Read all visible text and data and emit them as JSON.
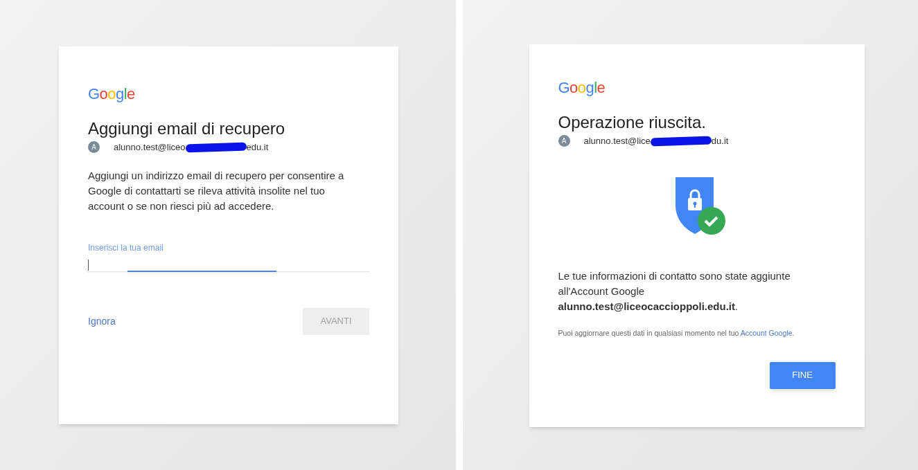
{
  "screens": [
    {
      "kind": "form",
      "logo": "Google",
      "title": "Aggiungi email di recupero",
      "avatar": "A",
      "email_parts": [
        "alunno.test@liceo",
        "edu.it"
      ],
      "description": "Aggiungi un indirizzo email di recupero per consentire a Google di contattarti se rileva attività insolite nel tuo account o se non riesci più ad accedere.",
      "field": {
        "label": "Inserisci la tua email",
        "focused": true
      },
      "link": "Ignora",
      "button": {
        "label": "AVANTI",
        "disabled": true
      }
    },
    {
      "kind": "success",
      "logo": "Google",
      "title": "Operazione riuscita.",
      "avatar": "A",
      "email_parts": [
        "alunno.test@lice",
        "du.it"
      ],
      "message": "Le tue informazioni di contatto sono state aggiunte all'Account Google **alunno.test@liceocaccioppoli.edu.it**.",
      "note": "Puoi aggiornare questi dati in qualsiasi momento nel tuo",
      "note_link": "Account Google.",
      "button": {
        "label": "FINE",
        "disabled": false
      }
    }
  ]
}
